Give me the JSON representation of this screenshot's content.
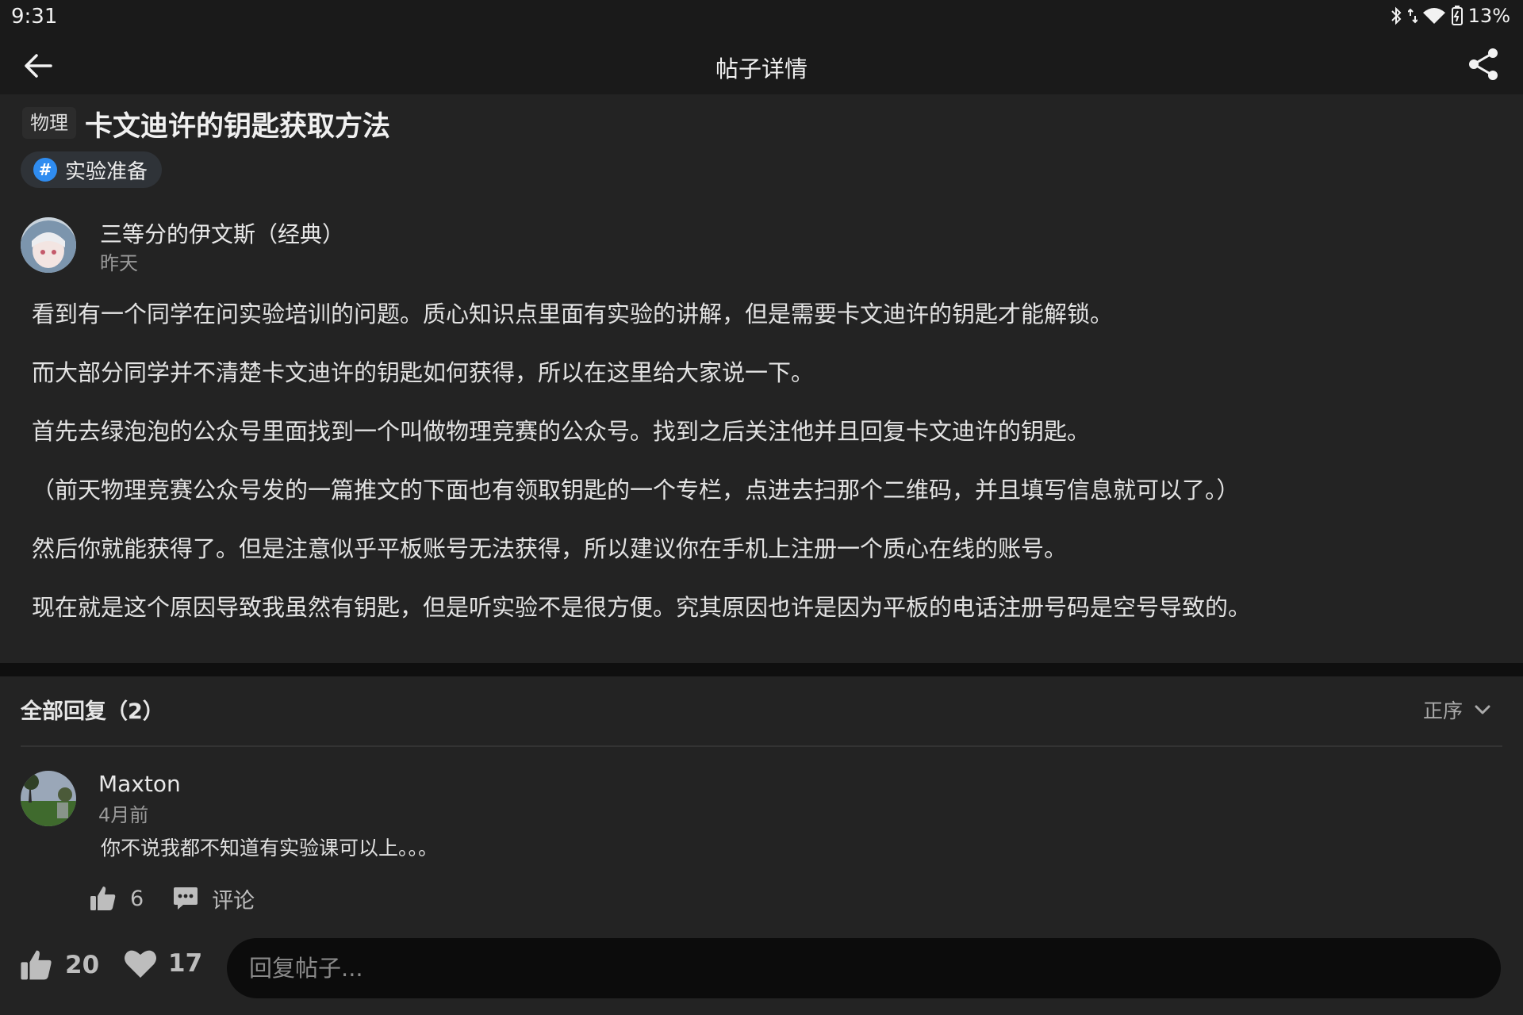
{
  "status_bar": {
    "time": "9:31",
    "battery": "13%",
    "icons": [
      "bluetooth-icon",
      "data-arrows-icon",
      "wifi-icon",
      "battery-icon"
    ]
  },
  "header": {
    "title": "帖子详情",
    "back_icon": "arrow-left-icon",
    "share_icon": "share-icon"
  },
  "post": {
    "subject": "物理",
    "title": "卡文迪许的钥匙获取方法",
    "topic": "实验准备",
    "author": {
      "name": "三等分的伊文斯（经典）",
      "time": "昨天"
    },
    "paragraphs": [
      "看到有一个同学在问实验培训的问题。质心知识点里面有实验的讲解，但是需要卡文迪许的钥匙才能解锁。",
      "而大部分同学并不清楚卡文迪许的钥匙如何获得，所以在这里给大家说一下。",
      "首先去绿泡泡的公众号里面找到一个叫做物理竞赛的公众号。找到之后关注他并且回复卡文迪许的钥匙。",
      "（前天物理竞赛公众号发的一篇推文的下面也有领取钥匙的一个专栏，点进去扫那个二维码，并且填写信息就可以了。）",
      "然后你就能获得了。但是注意似乎平板账号无法获得，所以建议你在手机上注册一个质心在线的账号。",
      "现在就是这个原因导致我虽然有钥匙，但是听实验不是很方便。究其原因也许是因为平板的电话注册号码是空号导致的。"
    ]
  },
  "replies": {
    "header": "全部回复（2）",
    "sort": "正序",
    "items": [
      {
        "name": "Maxton",
        "time": "4月前",
        "text": "你不说我都不知道有实验课可以上。。。",
        "likes": "6",
        "comment_label": "评论"
      }
    ]
  },
  "bottom_bar": {
    "likes": "20",
    "favorites": "17",
    "reply_placeholder": "回复帖子..."
  },
  "colors": {
    "background": "#232323",
    "bar": "#1a1a1a",
    "accent": "#2f8cf0",
    "input_bg": "#0c0c0c"
  }
}
